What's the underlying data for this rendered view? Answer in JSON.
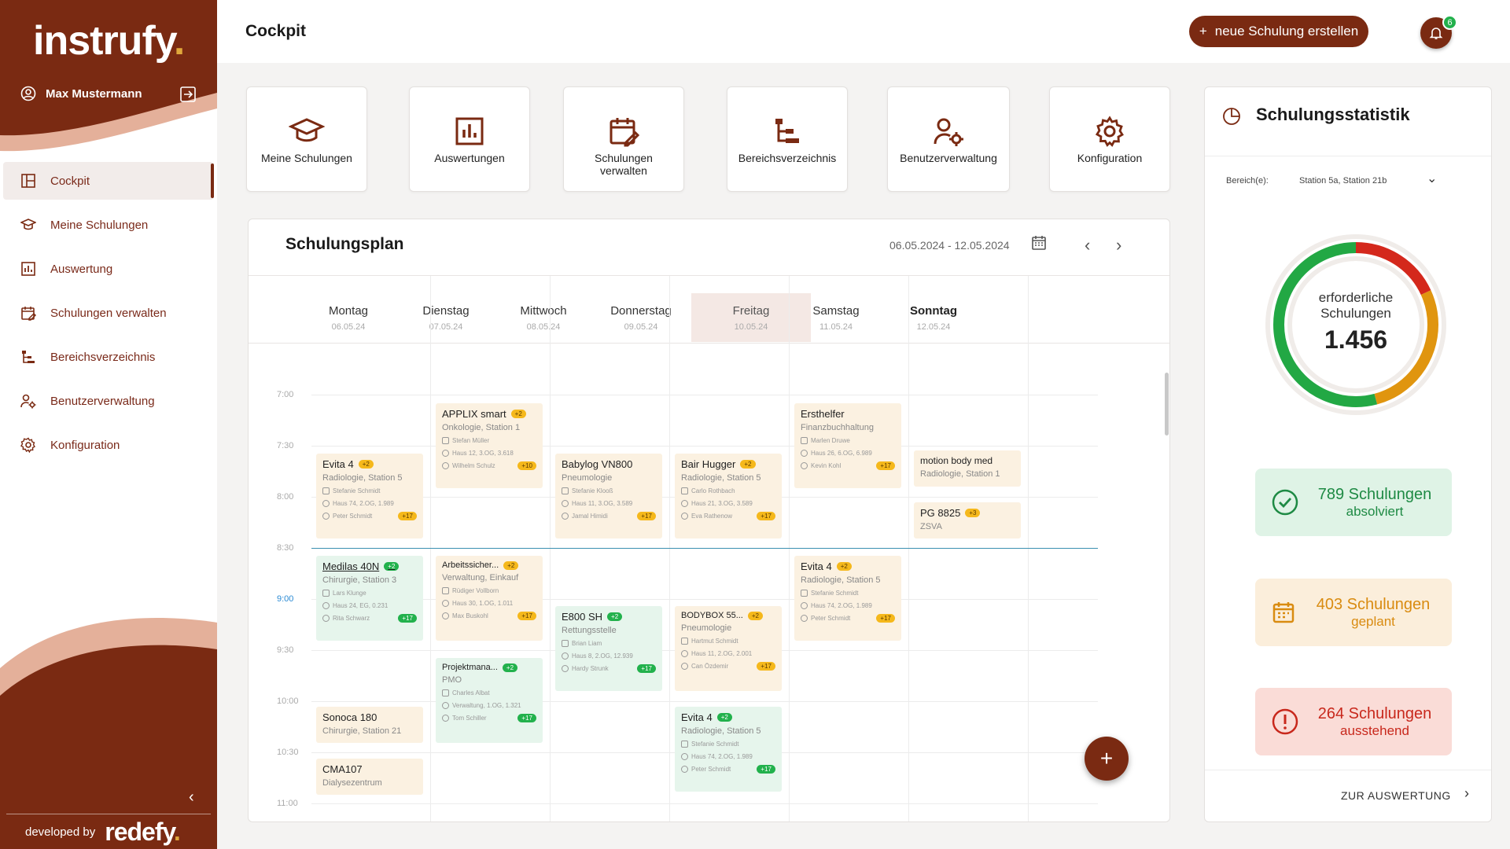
{
  "brand": {
    "logo": "instrufy",
    "logo_dot": ".",
    "user": "Max Mustermann",
    "developed_by": "developed by",
    "dev_brand": "redefy",
    "dev_dot": "."
  },
  "colors": {
    "primary": "#7a2a12",
    "accent": "#e0a83c",
    "green": "#22b14c",
    "orange": "#e0950f",
    "red": "#d4281c"
  },
  "sidebar": {
    "items": [
      {
        "label": "Cockpit",
        "icon": "dashboard-icon",
        "active": true
      },
      {
        "label": "Meine Schulungen",
        "icon": "graduation-cap-icon",
        "active": false
      },
      {
        "label": "Auswertung",
        "icon": "bar-chart-icon",
        "active": false
      },
      {
        "label": "Schulungen verwalten",
        "icon": "calendar-edit-icon",
        "active": false
      },
      {
        "label": "Bereichsverzeichnis",
        "icon": "tree-icon",
        "active": false
      },
      {
        "label": "Benutzerverwaltung",
        "icon": "user-gear-icon",
        "active": false
      },
      {
        "label": "Konfiguration",
        "icon": "gear-icon",
        "active": false
      }
    ]
  },
  "header": {
    "title": "Cockpit",
    "new_button": "neue Schulung erstellen",
    "notifications": "6"
  },
  "tiles": [
    {
      "label": "Meine Schulungen",
      "icon": "graduation-cap-icon"
    },
    {
      "label": "Auswertungen",
      "icon": "bar-chart-icon"
    },
    {
      "label": "Schulungen verwalten",
      "icon": "calendar-edit-icon"
    },
    {
      "label": "Bereichsverzeichnis",
      "icon": "tree-icon"
    },
    {
      "label": "Benutzerverwaltung",
      "icon": "user-gear-icon"
    },
    {
      "label": "Konfiguration",
      "icon": "gear-icon"
    }
  ],
  "plan": {
    "title": "Schulungsplan",
    "range": "06.05.2024 - 12.05.2024",
    "days": [
      {
        "name": "Montag",
        "date": "06.05.24"
      },
      {
        "name": "Dienstag",
        "date": "07.05.24"
      },
      {
        "name": "Mittwoch",
        "date": "08.05.24"
      },
      {
        "name": "Donnerstag",
        "date": "09.05.24"
      },
      {
        "name": "Freitag",
        "date": "10.05.24"
      },
      {
        "name": "Samstag",
        "date": "11.05.24"
      },
      {
        "name": "Sonntag",
        "date": "12.05.24"
      }
    ],
    "times": [
      "7:00",
      "7:30",
      "8:00",
      "8:30",
      "9:00",
      "9:30",
      "10:00",
      "10:30",
      "11:00"
    ],
    "events": [
      {
        "title": "APPLIX smart",
        "badge": "+2",
        "sub": "Onkologie, Station 1",
        "trainer": "Stefan Müller",
        "loc": "Haus 12, 3.OG, 3.618",
        "person": "Wilhelm Schulz",
        "count": "+10"
      },
      {
        "title": "Ersthelfer",
        "sub": "Finanzbuchhaltung",
        "trainer": "Marlen Druwe",
        "loc": "Haus 26, 6.OG, 6.989",
        "person": "Kevin Kohl",
        "count": "+17"
      },
      {
        "title": "Evita 4",
        "badge": "+2",
        "sub": "Radiologie, Station 5",
        "trainer": "Stefanie Schmidt",
        "loc": "Haus 74, 2.OG, 1.989",
        "person": "Peter Schmidt",
        "count": "+17"
      },
      {
        "title": "Babylog VN800",
        "sub": "Pneumologie",
        "trainer": "Stefanie Klooß",
        "loc": "Haus 11, 3.OG, 3.589",
        "person": "Jamal Himidi",
        "count": "+17"
      },
      {
        "title": "Bair Hugger",
        "badge": "+2",
        "sub": "Radiologie, Station 5",
        "trainer": "Carlo Rothbach",
        "loc": "Haus 21, 3.OG, 3.589",
        "person": "Eva Rathenow",
        "count": "+17"
      },
      {
        "title": "motion body med",
        "sub": "Radiologie, Station 1"
      },
      {
        "title": "PG 8825",
        "badge": "+3",
        "sub": "ZSVA"
      },
      {
        "title": "Medilas 40N",
        "badge": "+2",
        "sub": "Chirurgie, Station 3",
        "trainer": "Lars Klunge",
        "loc": "Haus 24, EG, 0.231",
        "person": "Rita Schwarz",
        "count": "+17"
      },
      {
        "title": "Arbeitssicher...",
        "badge": "+2",
        "sub": "Verwaltung, Einkauf",
        "trainer": "Rüdiger Vollborn",
        "loc": "Haus 30, 1.OG, 1.011",
        "person": "Max Buskohl",
        "count": "+17"
      },
      {
        "title": "Evita 4",
        "badge": "+2",
        "sub": "Radiologie, Station 5",
        "trainer": "Stefanie Schmidt",
        "loc": "Haus 74, 2.OG, 1.989",
        "person": "Peter Schmidt",
        "count": "+17"
      },
      {
        "title": "E800 SH",
        "badge": "+2",
        "sub": "Rettungsstelle",
        "trainer": "Brian Liam",
        "loc": "Haus 8, 2.OG, 12.939",
        "person": "Hardy Strunk",
        "count": "+17"
      },
      {
        "title": "BODYBOX 55...",
        "badge": "+2",
        "sub": "Pneumologie",
        "trainer": "Hartmut Schmidt",
        "loc": "Haus 11, 2.OG, 2.001",
        "person": "Can Özdemir",
        "count": "+17"
      },
      {
        "title": "Projektmana...",
        "badge": "+2",
        "sub": "PMO",
        "trainer": "Charles Albat",
        "loc": "Verwaltung, 1.OG, 1.321",
        "person": "Tom Schiller",
        "count": "+17"
      },
      {
        "title": "Sonoca 180",
        "sub": "Chirurgie, Station 21"
      },
      {
        "title": "Evita 4",
        "badge": "+2",
        "sub": "Radiologie, Station 5",
        "trainer": "Stefanie Schmidt",
        "loc": "Haus 74, 2.OG, 1.989",
        "person": "Peter Schmidt",
        "count": "+17"
      },
      {
        "title": "CMA107",
        "sub": "Dialysezentrum"
      }
    ]
  },
  "stats": {
    "title": "Schulungsstatistik",
    "filter_label": "Bereich(e):",
    "filter_value": "Station 5a, Station 21b",
    "ring_label": "erforderliche Schulungen",
    "ring_value": "1.456",
    "done": {
      "count": "789 Schulungen",
      "label": "absolviert",
      "value": 789
    },
    "planned": {
      "count": "403 Schulungen",
      "label": "geplant",
      "value": 403
    },
    "open": {
      "count": "264 Schulungen",
      "label": "ausstehend",
      "value": 264
    },
    "link": "ZUR AUSWERTUNG"
  }
}
